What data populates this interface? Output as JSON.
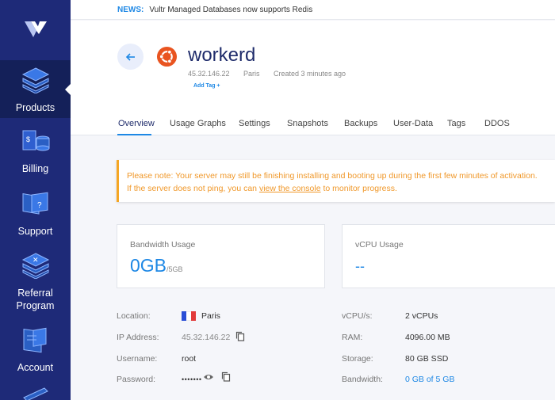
{
  "sidebar": {
    "items": [
      {
        "label": "Products",
        "icon": "products-icon"
      },
      {
        "label": "Billing",
        "icon": "billing-icon"
      },
      {
        "label": "Support",
        "icon": "support-icon"
      },
      {
        "label": "Referral Program",
        "icon": "referral-icon"
      },
      {
        "label": "Account",
        "icon": "account-icon"
      }
    ]
  },
  "news": {
    "tag": "NEWS:",
    "text": "Vultr Managed Databases now supports Redis"
  },
  "server": {
    "name": "workerd",
    "ip": "45.32.146.22",
    "location": "Paris",
    "created": "Created 3 minutes ago",
    "add_tag": "Add Tag +"
  },
  "tabs": [
    "Overview",
    "Usage Graphs",
    "Settings",
    "Snapshots",
    "Backups",
    "User-Data",
    "Tags",
    "DDOS"
  ],
  "notice": {
    "line1": "Please note: Your server may still be finishing installing and booting up during the first few minutes of activation.",
    "line2_pre": "If the server does not ping, you can ",
    "line2_link": "view the console",
    "line2_post": " to monitor progress."
  },
  "cards": {
    "bandwidth": {
      "label": "Bandwidth Usage",
      "value": "0GB",
      "sub": "/5GB"
    },
    "vcpu": {
      "label": "vCPU Usage",
      "value": "--"
    }
  },
  "details": {
    "location_label": "Location:",
    "location_value": "Paris",
    "ip_label": "IP Address:",
    "ip_value": "45.32.146.22",
    "username_label": "Username:",
    "username_value": "root",
    "password_label": "Password:",
    "password_value": "•••••••",
    "vcpus_label": "vCPU/s:",
    "vcpus_value": "2 vCPUs",
    "ram_label": "RAM:",
    "ram_value": "4096.00 MB",
    "storage_label": "Storage:",
    "storage_value": "80 GB SSD",
    "bandwidth_label": "Bandwidth:",
    "bandwidth_value": "0 GB of 5 GB"
  },
  "colors": {
    "sidebar": "#1e2a78",
    "accent": "#1e88e5",
    "warning": "#f5a623",
    "ubuntu": "#e95420"
  }
}
